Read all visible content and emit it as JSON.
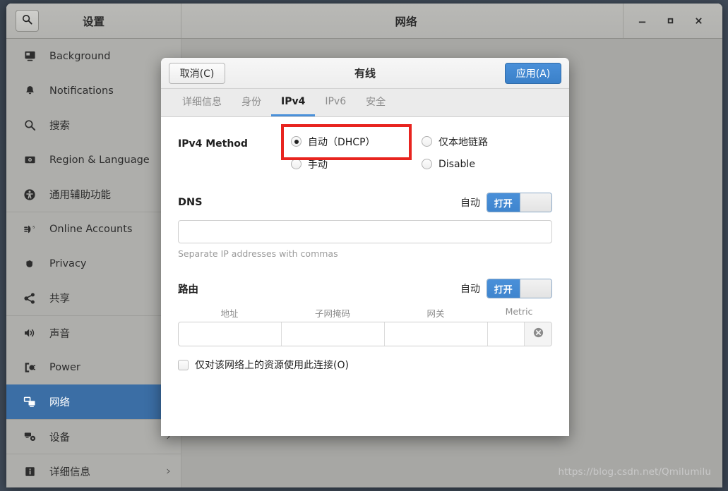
{
  "window": {
    "settings_title": "设置",
    "network_title": "网络",
    "search_icon": "search-icon",
    "controls": {
      "minimize": "–",
      "maximize": "□",
      "close": "✕"
    }
  },
  "sidebar": {
    "items": [
      {
        "label": "Background",
        "icon": "background-icon",
        "active": false,
        "chevron": ""
      },
      {
        "label": "Notifications",
        "icon": "bell-icon",
        "active": false,
        "chevron": ""
      },
      {
        "label": "搜索",
        "icon": "search-icon",
        "active": false,
        "chevron": ""
      },
      {
        "label": "Region & Language",
        "icon": "flag-icon",
        "active": false,
        "chevron": ""
      },
      {
        "label": "通用辅助功能",
        "icon": "accessibility-icon",
        "active": false,
        "chevron": ""
      },
      {
        "label": "Online Accounts",
        "icon": "online-accounts-icon",
        "active": false,
        "chevron": ""
      },
      {
        "label": "Privacy",
        "icon": "hand-icon",
        "active": false,
        "chevron": ""
      },
      {
        "label": "共享",
        "icon": "share-icon",
        "active": false,
        "chevron": ""
      },
      {
        "label": "声音",
        "icon": "speaker-icon",
        "active": false,
        "chevron": ""
      },
      {
        "label": "Power",
        "icon": "power-plug-icon",
        "active": false,
        "chevron": ""
      },
      {
        "label": "网络",
        "icon": "network-icon",
        "active": true,
        "chevron": ""
      },
      {
        "label": "设备",
        "icon": "devices-icon",
        "active": false,
        "chevron": "›"
      },
      {
        "label": "详细信息",
        "icon": "info-icon",
        "active": false,
        "chevron": "›"
      }
    ]
  },
  "network_panel": {
    "add_button_label": "+",
    "gear_icon": "gear-icon",
    "watermark": "https://blog.csdn.net/Qmilumilu"
  },
  "dialog": {
    "cancel_label": "取消(C)",
    "title": "有线",
    "apply_label": "应用(A)",
    "tabs": [
      {
        "label": "详细信息",
        "active": false
      },
      {
        "label": "身份",
        "active": false
      },
      {
        "label": "IPv4",
        "active": true
      },
      {
        "label": "IPv6",
        "active": false
      },
      {
        "label": "安全",
        "active": false
      }
    ],
    "ipv4_method": {
      "label": "IPv4 Method",
      "options": [
        {
          "label": "自动（DHCP）",
          "selected": true,
          "highlighted": true
        },
        {
          "label": "仅本地链路",
          "selected": false,
          "highlighted": false
        },
        {
          "label": "手动",
          "selected": false,
          "highlighted": false
        },
        {
          "label": "Disable",
          "selected": false,
          "highlighted": false
        }
      ],
      "highlight_color": "#e8241f"
    },
    "dns": {
      "title": "DNS",
      "auto_label": "自动",
      "toggle_state": "打开",
      "value": "",
      "hint": "Separate IP addresses with commas"
    },
    "routes": {
      "title": "路由",
      "auto_label": "自动",
      "toggle_state": "打开",
      "columns": [
        "地址",
        "子网掩码",
        "网关",
        "Metric"
      ],
      "rows": [
        {
          "address": "",
          "netmask": "",
          "gateway": "",
          "metric": ""
        }
      ],
      "delete_icon": "delete-circle-icon"
    },
    "restrict_checkbox": {
      "label": "仅对该网络上的资源使用此连接(O)",
      "checked": false
    }
  },
  "colors": {
    "accent": "#4a90d9",
    "sidebar_active": "#3b6ea5",
    "highlight": "#e8241f"
  }
}
